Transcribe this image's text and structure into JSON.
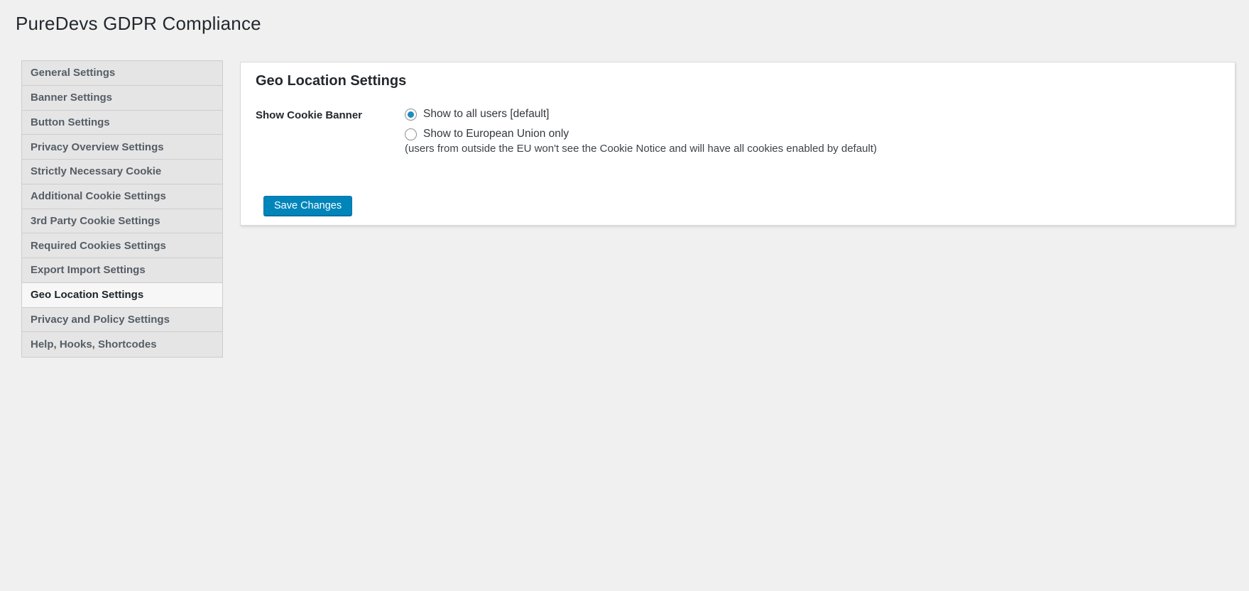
{
  "page": {
    "title": "PureDevs GDPR Compliance"
  },
  "sidebar": {
    "items": [
      {
        "label": "General Settings",
        "active": false
      },
      {
        "label": "Banner Settings",
        "active": false
      },
      {
        "label": "Button Settings",
        "active": false
      },
      {
        "label": "Privacy Overview Settings",
        "active": false
      },
      {
        "label": "Strictly Necessary Cookie",
        "active": false
      },
      {
        "label": "Additional Cookie Settings",
        "active": false
      },
      {
        "label": "3rd Party Cookie Settings",
        "active": false
      },
      {
        "label": "Required Cookies Settings",
        "active": false
      },
      {
        "label": "Export Import Settings",
        "active": false
      },
      {
        "label": "Geo Location Settings",
        "active": true
      },
      {
        "label": "Privacy and Policy Settings",
        "active": false
      },
      {
        "label": "Help, Hooks, Shortcodes",
        "active": false
      }
    ]
  },
  "panel": {
    "heading": "Geo Location Settings",
    "form": {
      "label": "Show Cookie Banner",
      "options": [
        {
          "label": "Show to all users [default]",
          "selected": true
        },
        {
          "label": "Show to European Union only",
          "selected": false,
          "note": "(users from outside the EU won't see the Cookie Notice and will have all cookies enabled by default)"
        }
      ]
    },
    "save_label": "Save Changes"
  },
  "colors": {
    "accent_button": "#0085ba",
    "radio_checked": "#1e8cbe",
    "page_background": "#f0f0f1"
  }
}
